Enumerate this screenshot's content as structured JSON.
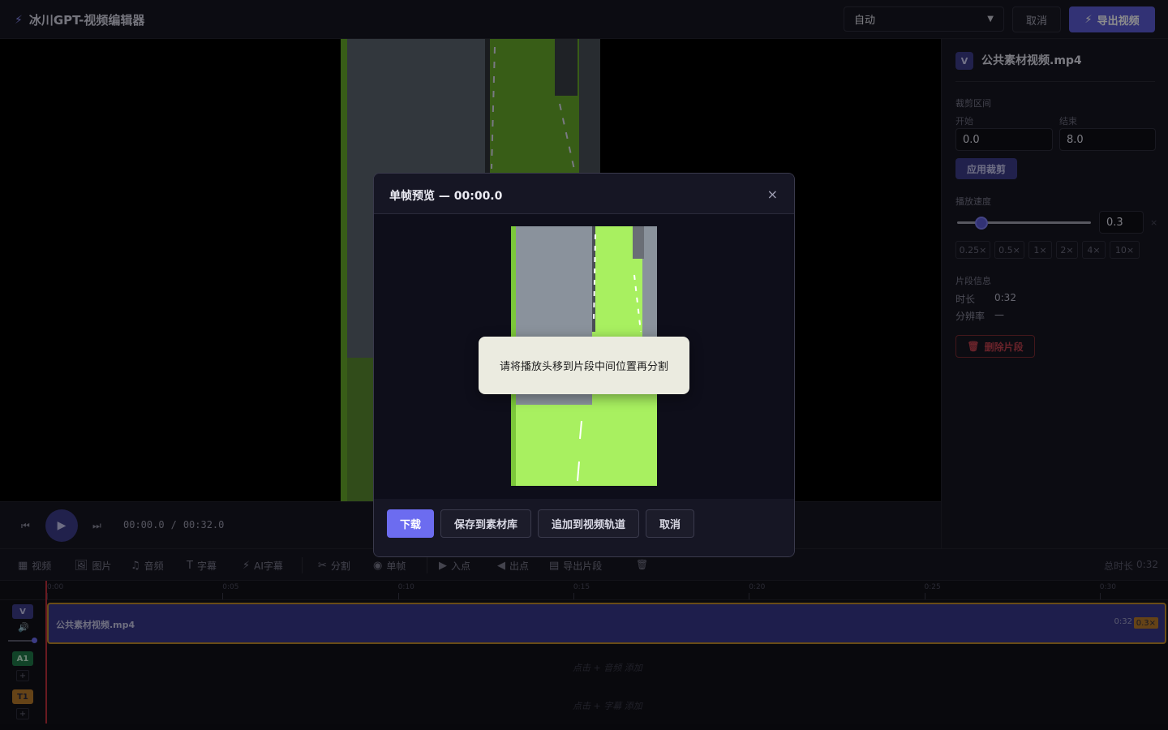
{
  "app": {
    "title": "冰川GPT-视频编辑器"
  },
  "topbar": {
    "quality": {
      "selected": "自动"
    },
    "cancel_label": "取消",
    "export_label": "导出视频"
  },
  "player": {
    "current_time": "00:00.0",
    "separator": "/",
    "total_time": "00:32.0"
  },
  "inspector": {
    "clip_badge": "V",
    "clip_name": "公共素材视频.mp4",
    "trim_section": "裁剪区间",
    "start_label": "开始",
    "start_value": "0.0",
    "end_label": "结束",
    "end_value": "8.0",
    "apply_label": "应用裁剪",
    "speed_section": "播放速度",
    "speed_value": "0.3",
    "speed_unit": "×",
    "speed_presets": [
      "0.25×",
      "0.5×",
      "1×",
      "2×",
      "4×",
      "10×"
    ],
    "info_section": "片段信息",
    "duration_label": "时长",
    "duration_value": "0:32",
    "resolution_label": "分辨率",
    "resolution_value": "—",
    "delete_label": "删除片段"
  },
  "toolbar": {
    "items": [
      {
        "label": "视频",
        "icon": "film-icon"
      },
      {
        "label": "图片",
        "icon": "image-icon"
      },
      {
        "label": "音频",
        "icon": "music-icon"
      },
      {
        "label": "字幕",
        "icon": "text-icon"
      },
      {
        "label": "AI字幕",
        "icon": "bolt-icon"
      },
      {
        "label": "分割",
        "icon": "scissors-icon"
      },
      {
        "label": "单帧",
        "icon": "camera-icon"
      },
      {
        "label": "入点",
        "icon": "in-point-icon"
      },
      {
        "label": "出点",
        "icon": "out-point-icon"
      },
      {
        "label": "导出片段",
        "icon": "film-export-icon"
      }
    ],
    "total_label": "总时长",
    "total_value": "0:32"
  },
  "timeline": {
    "ruler": [
      "0:00",
      "0:05",
      "0:10",
      "0:15",
      "0:20",
      "0:25",
      "0:30"
    ],
    "tracks": {
      "video_badge": "V",
      "audio_badge": "A1",
      "text_badge": "T1"
    },
    "video_clip": {
      "name": "公共素材视频.mp4",
      "duration": "0:32",
      "speed": "0.3×"
    },
    "audio_hint": "点击 + 音频 添加",
    "text_hint": "点击 + 字幕 添加",
    "volume_level": 1.0
  },
  "modal": {
    "title": "单帧预览 — 00:00.0",
    "close": "×",
    "buttons": {
      "download": "下载",
      "save_library": "保存到素材库",
      "append_track": "追加到视频轨道",
      "cancel": "取消"
    }
  },
  "toast": {
    "message": "请将播放头移到片段中间位置再分割"
  },
  "colors": {
    "accent": "#6c6cf0",
    "clip_fill": "#38388a",
    "clip_border": "#c08a28",
    "danger": "#c0404e",
    "frame_green": "#a8f060"
  }
}
